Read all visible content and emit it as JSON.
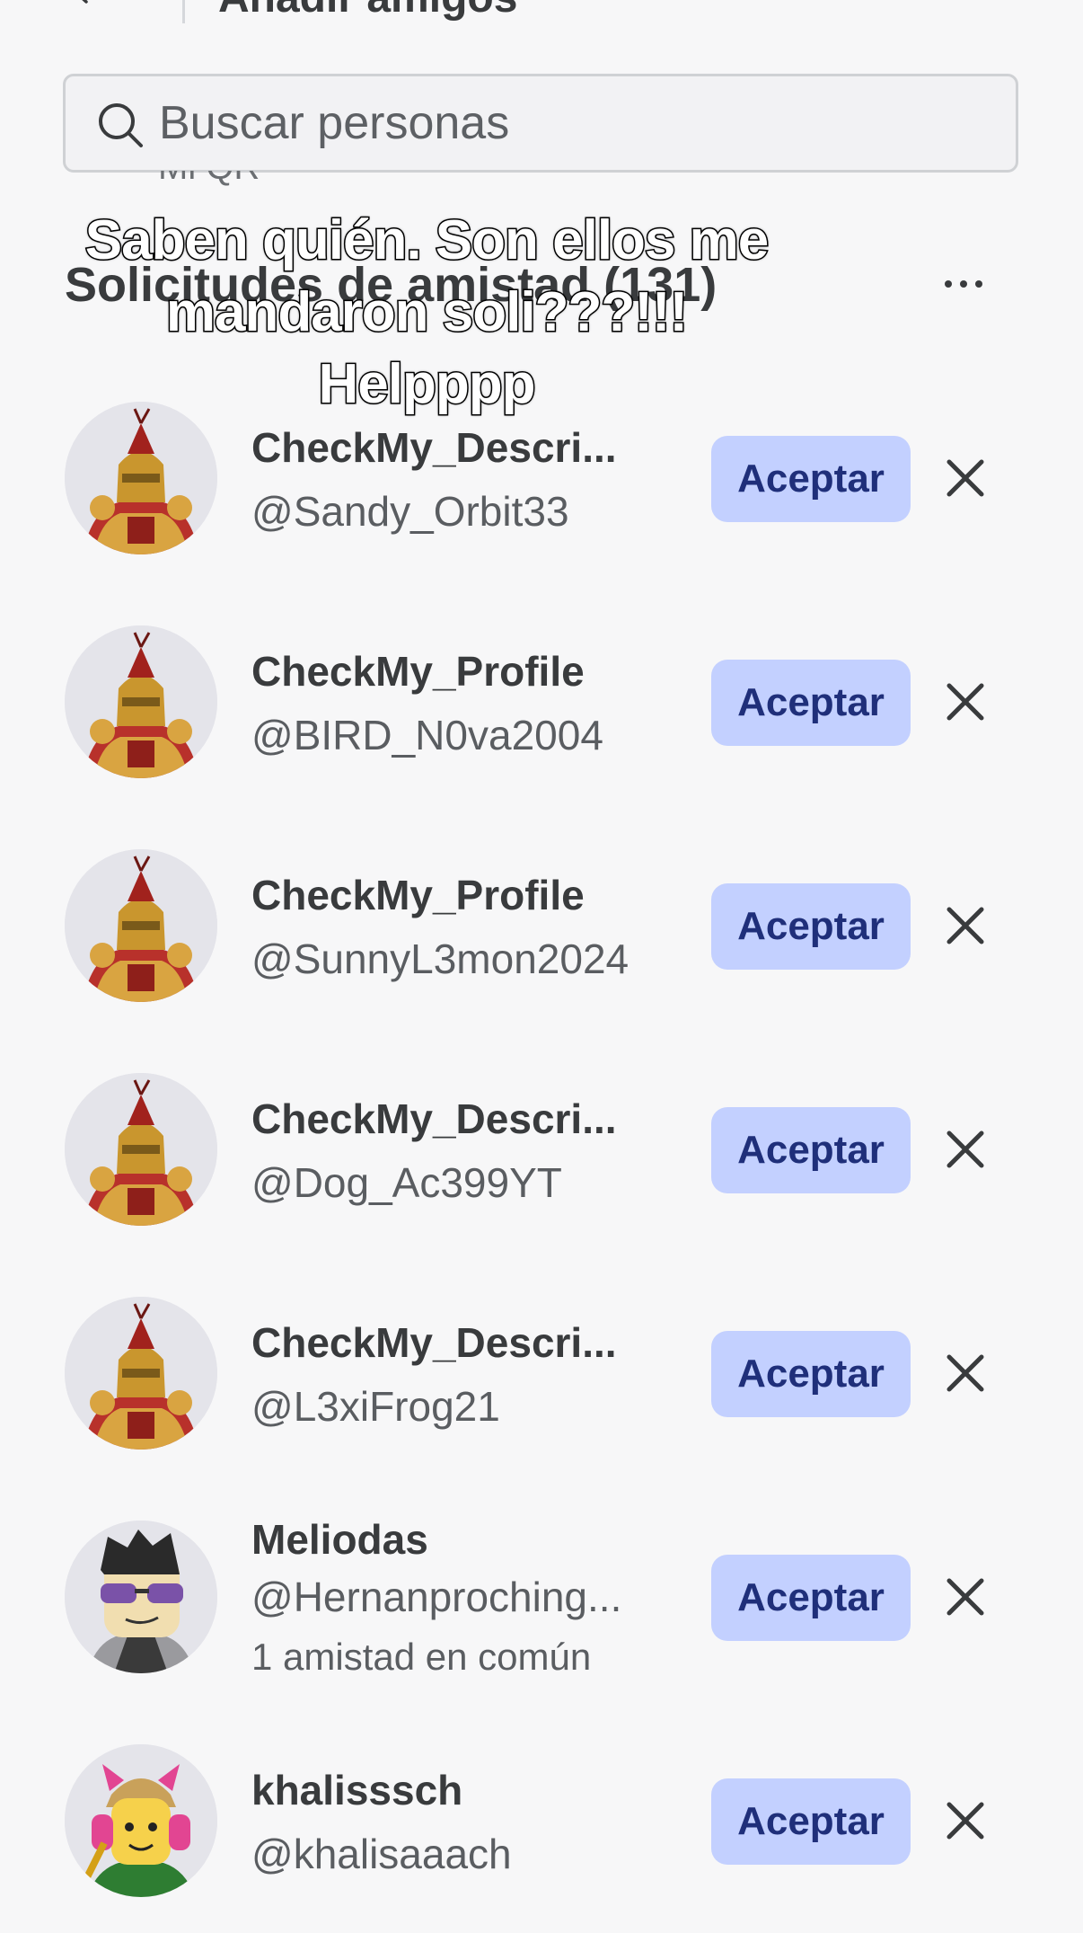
{
  "header": {
    "title": "Añadir amigos"
  },
  "search": {
    "placeholder": "Buscar personas"
  },
  "partial_label": "Mi QR",
  "section": {
    "title": "Solicitudes de amistad (131)"
  },
  "overlay_caption": [
    "Saben quién. Son ellos me",
    "mandaron soli???!!!",
    "Helpppp"
  ],
  "accept_label": "Aceptar",
  "requests": [
    {
      "name": "CheckMy_Descri...",
      "handle": "@Sandy_Orbit33",
      "avatar": "knight-avatar"
    },
    {
      "name": "CheckMy_Profile",
      "handle": "@BIRD_N0va2004",
      "avatar": "knight-avatar"
    },
    {
      "name": "CheckMy_Profile",
      "handle": "@SunnyL3mon2024",
      "avatar": "knight-avatar"
    },
    {
      "name": "CheckMy_Descri...",
      "handle": "@Dog_Ac399YT",
      "avatar": "knight-avatar"
    },
    {
      "name": "CheckMy_Descri...",
      "handle": "@L3xiFrog21",
      "avatar": "knight-avatar"
    },
    {
      "name": "Meliodas",
      "handle": "@Hernanproching...",
      "mutual": "1 amistad en común",
      "avatar": "sunglasses-avatar"
    },
    {
      "name": "khalisssch",
      "handle": "@khalisaaach",
      "avatar": "headphones-avatar"
    }
  ],
  "colors": {
    "accent_button": "#c3d0ff",
    "accent_text": "#1f2f7a",
    "background": "#f7f7f8"
  }
}
